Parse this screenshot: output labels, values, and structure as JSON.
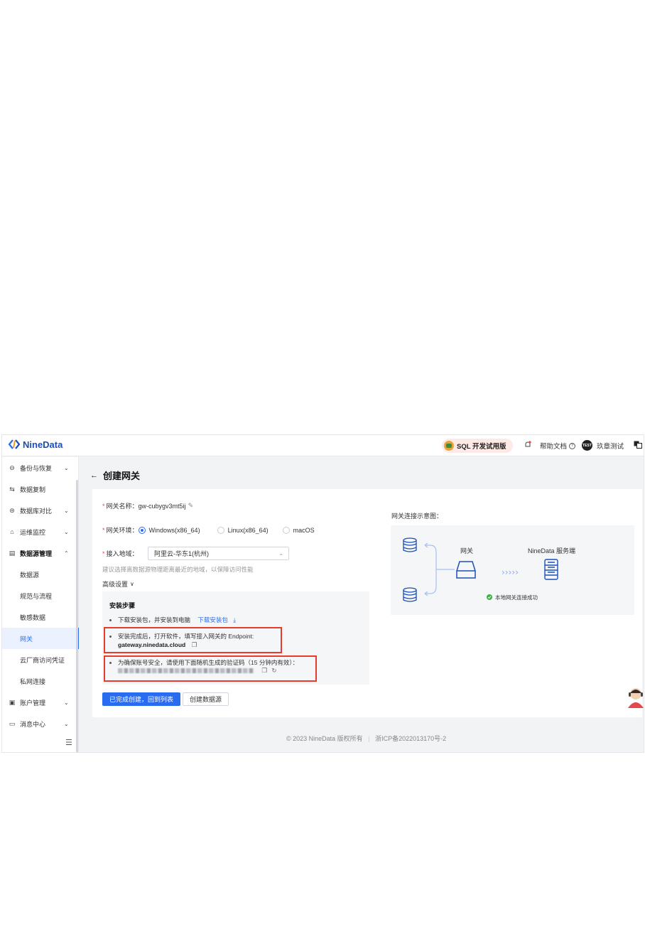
{
  "brand": {
    "name": "NineData"
  },
  "header": {
    "sql_badge": "SQL 开发试用版",
    "help_docs": "帮助文档",
    "user_avatar_text": "TEST",
    "user_name": "玖章测试"
  },
  "sidebar": {
    "items": [
      {
        "label": "备份与恢复",
        "icon": "backup-icon",
        "expandable": true
      },
      {
        "label": "数据复制",
        "icon": "replicate-icon",
        "expandable": false
      },
      {
        "label": "数据库对比",
        "icon": "compare-icon",
        "expandable": true
      },
      {
        "label": "运维监控",
        "icon": "monitor-icon",
        "expandable": true
      },
      {
        "label": "数据源管理",
        "icon": "datasource-icon",
        "expandable": true,
        "expanded": true
      },
      {
        "label": "数据源"
      },
      {
        "label": "规范与流程"
      },
      {
        "label": "敏感数据"
      },
      {
        "label": "网关",
        "active": true
      },
      {
        "label": "云厂商访问凭证"
      },
      {
        "label": "私网连接"
      },
      {
        "label": "账户管理",
        "icon": "account-icon",
        "expandable": true
      },
      {
        "label": "消息中心",
        "icon": "message-icon",
        "expandable": true
      }
    ]
  },
  "page": {
    "title": "创建网关"
  },
  "form": {
    "name_label": "网关名称：",
    "name_value": "gw-cubygv3mt5ij",
    "env_label": "网关环境：",
    "env_options": [
      "Windows(x86_64)",
      "Linux(x86_64)",
      "macOS"
    ],
    "env_selected": "Windows(x86_64)",
    "region_label": "接入地域：",
    "region_value": "阿里云-华东1(杭州)",
    "region_hint": "建议选择离数据源物理距离最近的地域，以保障访问性能",
    "advanced": "高级设置"
  },
  "steps": {
    "title": "安装步骤",
    "step1_text": "下载安装包，并安装到电脑",
    "step1_link": "下载安装包",
    "step2_text": "安装完成后，打开软件，填写接入网关的 Endpoint:",
    "step2_endpoint": "gateway.ninedata.cloud",
    "step3_text": "为确保账号安全，请使用下面随机生成的验证码（15 分钟内有效）："
  },
  "buttons": {
    "done": "已完成创建，回到列表",
    "create_datasource": "创建数据源"
  },
  "diagram": {
    "title": "网关连接示意图：",
    "gateway_label": "网关",
    "server_label": "NineData 服务端",
    "status": "本地网关连接成功",
    "status_color": "#3cb043"
  },
  "footer": {
    "copyright": "© 2023 NineData 版权所有",
    "icp": "浙ICP备2022013170号-2"
  },
  "colors": {
    "primary": "#2a6cf0",
    "highlight_box": "#e63b2e"
  }
}
